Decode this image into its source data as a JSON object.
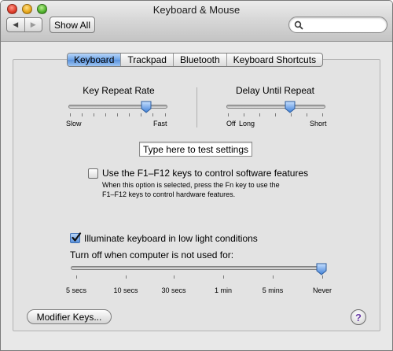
{
  "window": {
    "title": "Keyboard & Mouse"
  },
  "toolbar": {
    "back_arrow": "◀",
    "forward_arrow": "▶",
    "show_all_label": "Show All",
    "search_value": ""
  },
  "tabs": [
    {
      "label": "Keyboard",
      "selected": true
    },
    {
      "label": "Trackpad",
      "selected": false
    },
    {
      "label": "Bluetooth",
      "selected": false
    },
    {
      "label": "Keyboard Shortcuts",
      "selected": false
    }
  ],
  "key_repeat": {
    "title": "Key Repeat Rate",
    "min_label": "Slow",
    "max_label": "Fast",
    "value_fraction": 0.8
  },
  "delay_repeat": {
    "title": "Delay Until Repeat",
    "min_label": "Off",
    "mid_label": "Long",
    "max_label": "Short",
    "value_fraction": 0.65
  },
  "test_field": {
    "value": "Type here to test settings"
  },
  "fkeys": {
    "checked": false,
    "label": "Use the F1–F12 keys to control software features",
    "help_line1": "When this option is selected, press the Fn key to use the",
    "help_line2": "F1–F12 keys to control hardware features."
  },
  "illuminate": {
    "checked": true,
    "label": "Illuminate keyboard in low light conditions"
  },
  "turn_off": {
    "title": "Turn off when computer is not used for:",
    "stops": [
      "5 secs",
      "10 secs",
      "30 secs",
      "1 min",
      "5 mins",
      "Never"
    ],
    "selected_stop": "Never"
  },
  "buttons": {
    "modifier_keys_label": "Modifier Keys..."
  },
  "help": {
    "label": "?"
  },
  "colors": {
    "accent": "#5a92dc",
    "help_glyph": "#6b3ea8"
  }
}
